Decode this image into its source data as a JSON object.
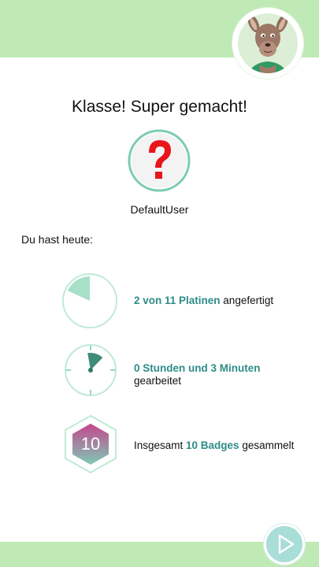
{
  "summary": {
    "title": "Klasse! Super gemacht!",
    "username": "DefaultUser",
    "intro": "Du hast heute:"
  },
  "stats": {
    "boards": {
      "highlight": "2 von 11 Platinen",
      "suffix": " angefertigt",
      "done": 2,
      "total": 11
    },
    "time": {
      "highlight": "0 Stunden und 3 Minuten",
      "suffix": " gearbeitet",
      "hours": 0,
      "minutes": 3
    },
    "badges": {
      "prefix": "Insgesamt ",
      "highlight": "10 Badges",
      "suffix": " gesammelt",
      "count": "10"
    }
  },
  "icons": {
    "avatar": "kangaroo-mascot-icon",
    "profile": "question-mark-icon",
    "next": "play-arrow-icon"
  },
  "colors": {
    "bar_green": "#bfeab5",
    "accent_teal": "#2e8c87",
    "ring_green": "#a8e6c4",
    "badge_pink": "#c04a8a"
  }
}
